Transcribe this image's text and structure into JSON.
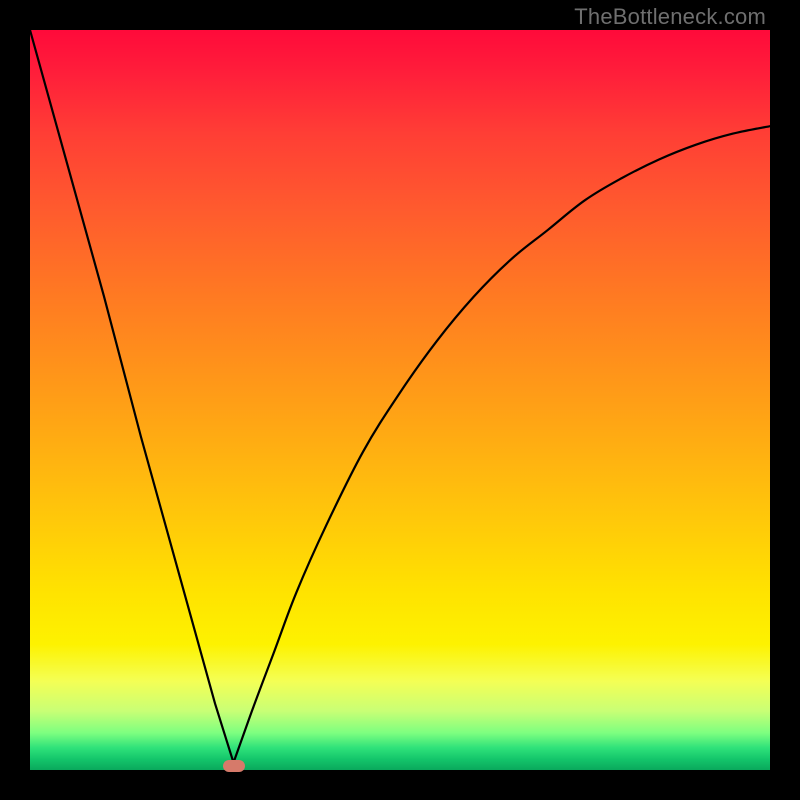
{
  "watermark": "TheBottleneck.com",
  "chart_data": {
    "type": "line",
    "title": "",
    "xlabel": "",
    "ylabel": "",
    "xlim": [
      0,
      100
    ],
    "ylim": [
      0,
      100
    ],
    "grid": false,
    "legend": false,
    "background_gradient": [
      "#ff0a3a",
      "#ff7a22",
      "#ffe300",
      "#14c66b"
    ],
    "series": [
      {
        "name": "left-branch",
        "x": [
          0,
          5,
          10,
          15,
          20,
          25,
          27.5
        ],
        "values": [
          100,
          82,
          64,
          45,
          27,
          9,
          1
        ]
      },
      {
        "name": "right-branch",
        "x": [
          27.5,
          30,
          33,
          36,
          40,
          45,
          50,
          55,
          60,
          65,
          70,
          75,
          80,
          85,
          90,
          95,
          100
        ],
        "values": [
          1,
          8,
          16,
          24,
          33,
          43,
          51,
          58,
          64,
          69,
          73,
          77,
          80,
          82.5,
          84.5,
          86,
          87
        ]
      }
    ],
    "marker": {
      "x": 27.5,
      "y": 0.5,
      "color": "#d67a6a"
    }
  }
}
